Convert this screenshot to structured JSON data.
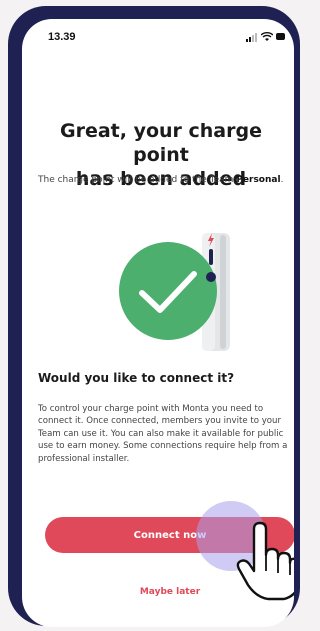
{
  "status_bar": {
    "time": "13.39"
  },
  "content": {
    "title_line1": "Great, your charge point",
    "title_line2": "has been added",
    "subtitle_prefix": "The charge point will be added to the Team",
    "team_name": "Personal",
    "subtitle_suffix": ".",
    "section_heading": "Would you like to connect it?",
    "body": "To control your charge point with Monta you need to connect it. Once connected, members you invite to your Team can use it. You can also make it available for public use to earn money. Some connections require help from a professional installer."
  },
  "actions": {
    "connect_label": "Connect now",
    "maybe_later_label": "Maybe later"
  },
  "colors": {
    "accent": "#e04959",
    "success": "#4caf6e",
    "frame": "#1f2152"
  },
  "icons": [
    "checkmark-icon",
    "charger-icon",
    "lightning-icon",
    "hand-cursor-icon",
    "signal-icon",
    "wifi-icon",
    "battery-icon"
  ]
}
